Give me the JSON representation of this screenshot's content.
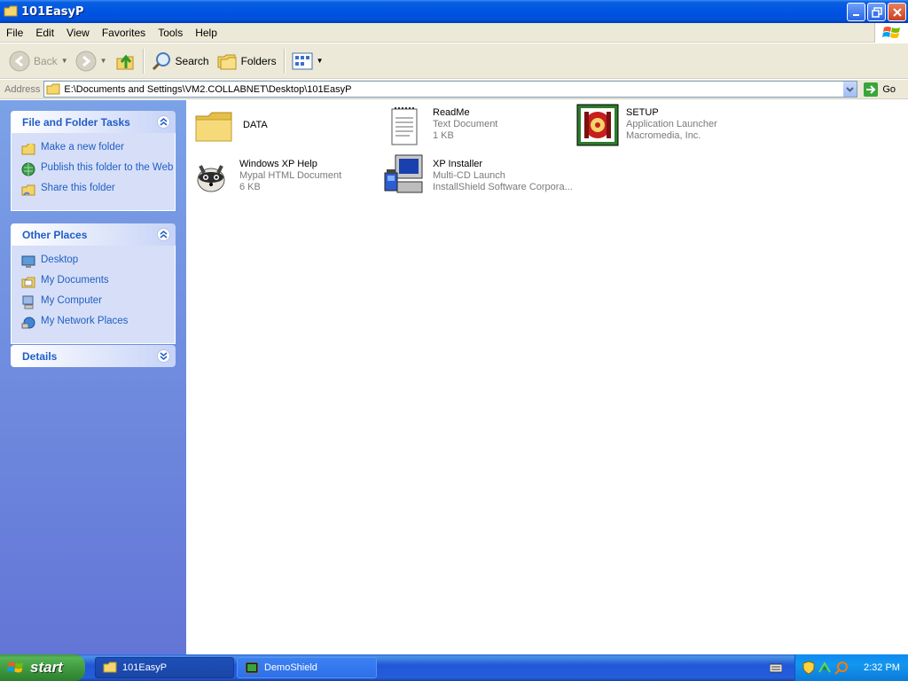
{
  "window": {
    "title": "101EasyP"
  },
  "menu": [
    "File",
    "Edit",
    "View",
    "Favorites",
    "Tools",
    "Help"
  ],
  "toolbar": {
    "back_label": "Back",
    "search_label": "Search",
    "folders_label": "Folders"
  },
  "address": {
    "label": "Address",
    "path": "E:\\Documents and Settings\\VM2.COLLABNET\\Desktop\\101EasyP",
    "go_label": "Go"
  },
  "panels": {
    "file_tasks": {
      "title": "File and Folder Tasks",
      "items": [
        "Make a new folder",
        "Publish this folder to the Web",
        "Share this folder"
      ]
    },
    "other_places": {
      "title": "Other Places",
      "items": [
        "Desktop",
        "My Documents",
        "My Computer",
        "My Network Places"
      ]
    },
    "details": {
      "title": "Details"
    }
  },
  "files": [
    {
      "name": "DATA",
      "type": "",
      "detail": "",
      "icon": "folder-icon"
    },
    {
      "name": "ReadMe",
      "type": "Text Document",
      "detail": "1 KB",
      "icon": "text-document-icon"
    },
    {
      "name": "SETUP",
      "type": "Application Launcher",
      "detail": "Macromedia, Inc.",
      "icon": "setup-app-icon"
    },
    {
      "name": "Windows XP Help",
      "type": "Mypal HTML Document",
      "detail": "6 KB",
      "icon": "raccoon-html-icon"
    },
    {
      "name": "XP Installer",
      "type": "Multi-CD Launch",
      "detail": "InstallShield Software Corpora...",
      "icon": "installer-computer-icon"
    }
  ],
  "taskbar": {
    "start_label": "start",
    "tasks": [
      "101EasyP",
      "DemoShield"
    ],
    "clock": "2:32 PM"
  },
  "colors": {
    "title_blue": "#0054e3",
    "panel_link": "#215dc6",
    "sidebar_top": "#7ba2e7",
    "sidebar_bottom": "#6375d6",
    "start_green": "#3c963c"
  }
}
